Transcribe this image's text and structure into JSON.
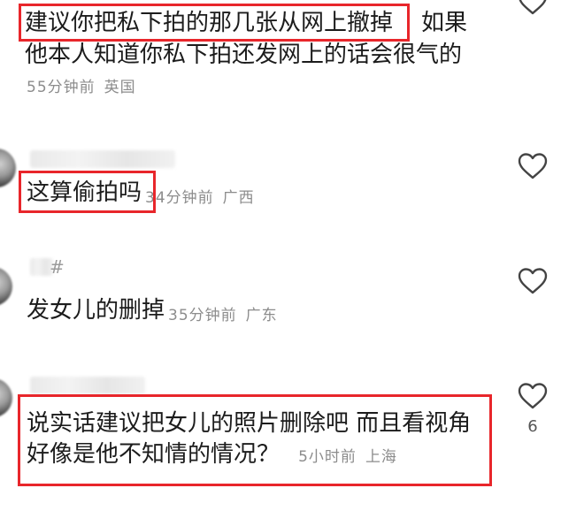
{
  "comments": [
    {
      "line1_highlight": "建议你把私下拍的那几张从网上撤掉",
      "line1_rest": "如果",
      "line2": "他本人知道你私下拍还发网上的话会很气的",
      "time": "55分钟前",
      "location": "英国"
    },
    {
      "text": "这算偷拍吗",
      "time": "34分钟前",
      "location": "广西"
    },
    {
      "username_fragment": "#",
      "text": "发女儿的删掉",
      "time": "35分钟前",
      "location": "广东"
    },
    {
      "line1": "说实话建议把女儿的照片删除吧 而且看视角",
      "line2": "好像是他不知情的情况？",
      "time": "5小时前",
      "location": "上海",
      "like_count": "6"
    }
  ],
  "colors": {
    "highlight_border": "#e8262b",
    "meta_text": "#8c8c8c",
    "heart_stroke": "#444444"
  },
  "icons": [
    "heart-outline-icon"
  ]
}
